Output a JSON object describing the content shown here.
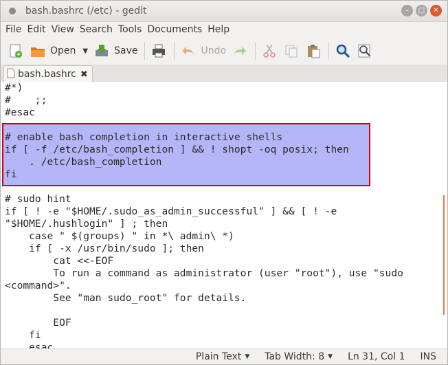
{
  "window": {
    "title": "bash.bashrc (/etc) - gedit"
  },
  "menu": [
    "File",
    "Edit",
    "View",
    "Search",
    "Tools",
    "Documents",
    "Help"
  ],
  "toolbar": {
    "open_label": "Open",
    "save_label": "Save",
    "undo_label": "Undo"
  },
  "tab": {
    "label": "bash.bashrc"
  },
  "editor": {
    "lines": [
      "#*)",
      "#    ;;",
      "#esac",
      "",
      "# enable bash completion in interactive shells",
      "if [ -f /etc/bash_completion ] && ! shopt -oq posix; then",
      "    . /etc/bash_completion",
      "fi",
      "",
      "# sudo hint",
      "if [ ! -e \"$HOME/.sudo_as_admin_successful\" ] && [ ! -e",
      "\"$HOME/.hushlogin\" ] ; then",
      "    case \" $(groups) \" in *\\ admin\\ *)",
      "    if [ -x /usr/bin/sudo ]; then",
      "        cat <<-EOF",
      "        To run a command as administrator (user \"root\"), use \"sudo",
      "<command>\".",
      "        See \"man sudo_root\" for details.",
      "",
      "        EOF",
      "    fi",
      "    esac"
    ]
  },
  "status": {
    "language": "Plain Text",
    "tab_width": "Tab Width:  8",
    "position": "Ln 31, Col 1",
    "mode": "INS"
  },
  "colors": {
    "selection": "#b5b5f7",
    "highlight_border": "#d0021b",
    "close_button": "#e2572a"
  }
}
